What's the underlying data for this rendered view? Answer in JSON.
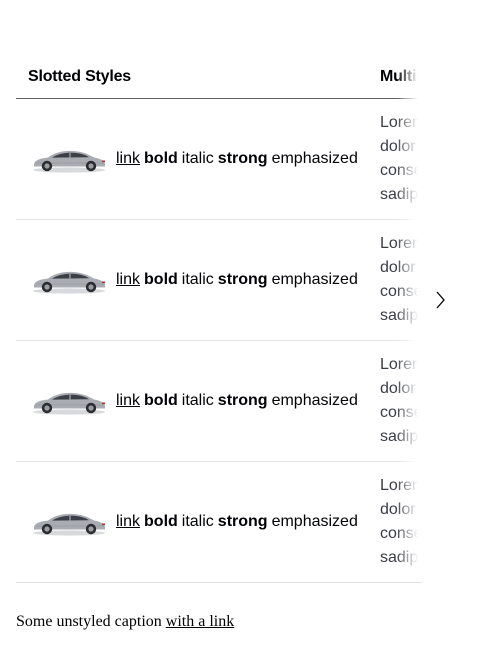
{
  "table": {
    "headers": [
      "Slotted Styles",
      "Multiline text"
    ],
    "rows": [
      {
        "link": "link",
        "bold": "bold",
        "italic": "italic",
        "strong": "strong",
        "emphasized": "emphasized",
        "multiline": [
          "Lorem ipsum",
          "dolor sit amet,",
          "consetetur",
          "sadipscing"
        ]
      },
      {
        "link": "link",
        "bold": "bold",
        "italic": "italic",
        "strong": "strong",
        "emphasized": "emphasized",
        "multiline": [
          "Lorem ipsum",
          "dolor sit amet,",
          "consetetur",
          "sadipscing"
        ]
      },
      {
        "link": "link",
        "bold": "bold",
        "italic": "italic",
        "strong": "strong",
        "emphasized": "emphasized",
        "multiline": [
          "Lorem ipsum",
          "dolor sit amet,",
          "consetetur",
          "sadipscing"
        ]
      },
      {
        "link": "link",
        "bold": "bold",
        "italic": "italic",
        "strong": "strong",
        "emphasized": "emphasized",
        "multiline": [
          "Lorem ipsum",
          "dolor sit amet,",
          "consetetur",
          "sadipscing"
        ]
      }
    ],
    "scroll_icon": "chevron-right-icon"
  },
  "caption": {
    "text": "Some unstyled caption",
    "link": "with a link"
  },
  "colors": {
    "text": "#010205",
    "header_border": "#5c5f66",
    "row_border": "#e2e4e8",
    "car_body": "#a9adb3"
  }
}
